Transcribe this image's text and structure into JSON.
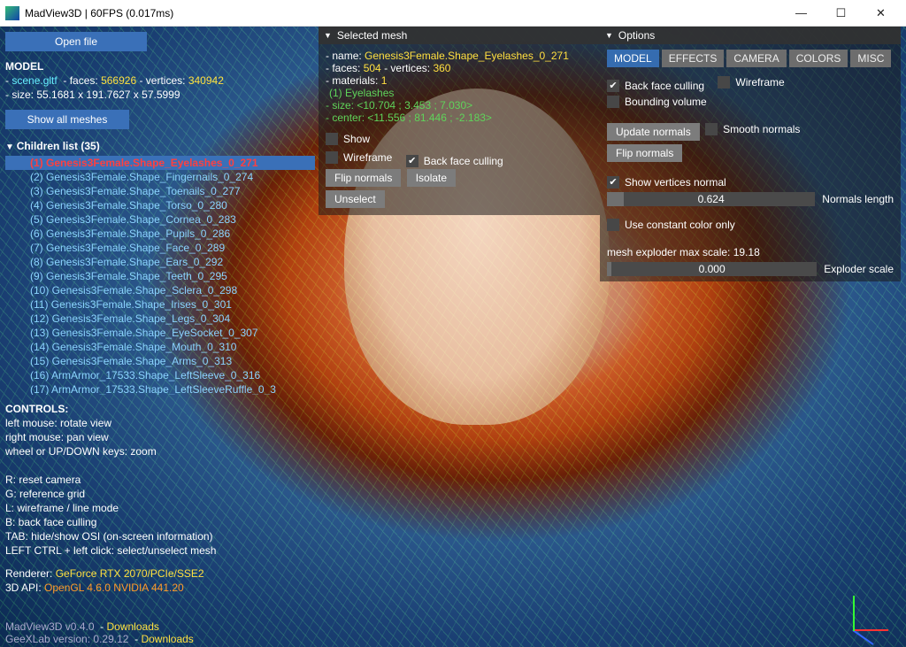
{
  "window": {
    "title": "MadView3D | 60FPS (0.017ms)"
  },
  "left": {
    "open_file": "Open file",
    "model_header": "MODEL",
    "scene_file": "scene.gltf",
    "faces_label": "faces:",
    "faces": "566926",
    "vertices_label": "vertices:",
    "vertices": "340942",
    "size_label": "size:",
    "size": "55.1681 x 191.7627 x 57.5999",
    "show_all": "Show all meshes",
    "children_header": "Children list (35)",
    "children": [
      "(1) Genesis3Female.Shape_Eyelashes_0_271",
      "(2) Genesis3Female.Shape_Fingernails_0_274",
      "(3) Genesis3Female.Shape_Toenails_0_277",
      "(4) Genesis3Female.Shape_Torso_0_280",
      "(5) Genesis3Female.Shape_Cornea_0_283",
      "(6) Genesis3Female.Shape_Pupils_0_286",
      "(7) Genesis3Female.Shape_Face_0_289",
      "(8) Genesis3Female.Shape_Ears_0_292",
      "(9) Genesis3Female.Shape_Teeth_0_295",
      "(10) Genesis3Female.Shape_Sclera_0_298",
      "(11) Genesis3Female.Shape_Irises_0_301",
      "(12) Genesis3Female.Shape_Legs_0_304",
      "(13) Genesis3Female.Shape_EyeSocket_0_307",
      "(14) Genesis3Female.Shape_Mouth_0_310",
      "(15) Genesis3Female.Shape_Arms_0_313",
      "(16) ArmArmor_17533.Shape_LeftSleeve_0_316",
      "(17) ArmArmor_17533.Shape_LeftSleeveRuffle_0_3"
    ],
    "selected_index": 0
  },
  "controls": {
    "header": "CONTROLS:",
    "lines": [
      "left mouse: rotate view",
      "right mouse: pan view",
      "wheel or UP/DOWN keys: zoom",
      "",
      "R: reset camera",
      "G: reference grid",
      "L: wireframe / line mode",
      "B: back face culling",
      "TAB: hide/show OSI (on-screen information)",
      "LEFT CTRL + left click: select/unselect mesh"
    ],
    "renderer_label": "Renderer:",
    "renderer": "GeForce RTX 2070/PCIe/SSE2",
    "api_label": "3D API:",
    "api": "OpenGL 4.6.0 NVIDIA 441.20"
  },
  "footer": {
    "app_ver": "MadView3D v0.4.0",
    "app_link": "Downloads",
    "lab_ver": "GeeXLab version: 0.29.12",
    "lab_link": "Downloads"
  },
  "selmesh": {
    "title": "Selected mesh",
    "name_label": "name:",
    "name": "Genesis3Female.Shape_Eyelashes_0_271",
    "fv_label1": "faces:",
    "faces": "504",
    "fv_label2": "vertices:",
    "vertices": "360",
    "materials_label": "materials:",
    "materials": "1",
    "mat_item": "(1) Eyelashes",
    "size_label": "size:",
    "size": "<10.704 ; 3.453 ; 7.030>",
    "center_label": "center:",
    "center": "<11.556 ; 81.446 ; -2.183>",
    "chk_show": "Show",
    "chk_wire": "Wireframe",
    "chk_bfc": "Back face culling",
    "btn_flip": "Flip normals",
    "btn_isolate": "Isolate",
    "btn_unselect": "Unselect"
  },
  "options": {
    "title": "Options",
    "tabs": [
      "MODEL",
      "EFFECTS",
      "CAMERA",
      "COLORS",
      "MISC"
    ],
    "active_tab": 0,
    "chk_bfc": "Back face culling",
    "chk_wire": "Wireframe",
    "chk_bv": "Bounding volume",
    "btn_update_normals": "Update normals",
    "chk_smooth": "Smooth normals",
    "btn_flip_normals": "Flip normals",
    "chk_show_vn": "Show vertices normal",
    "slider_nlen_label": "Normals length",
    "slider_nlen": "0.624",
    "chk_const_color": "Use constant color only",
    "exploder_header": "mesh exploder max scale: 19.18",
    "slider_exp_label": "Exploder scale",
    "slider_exp": "0.000"
  }
}
